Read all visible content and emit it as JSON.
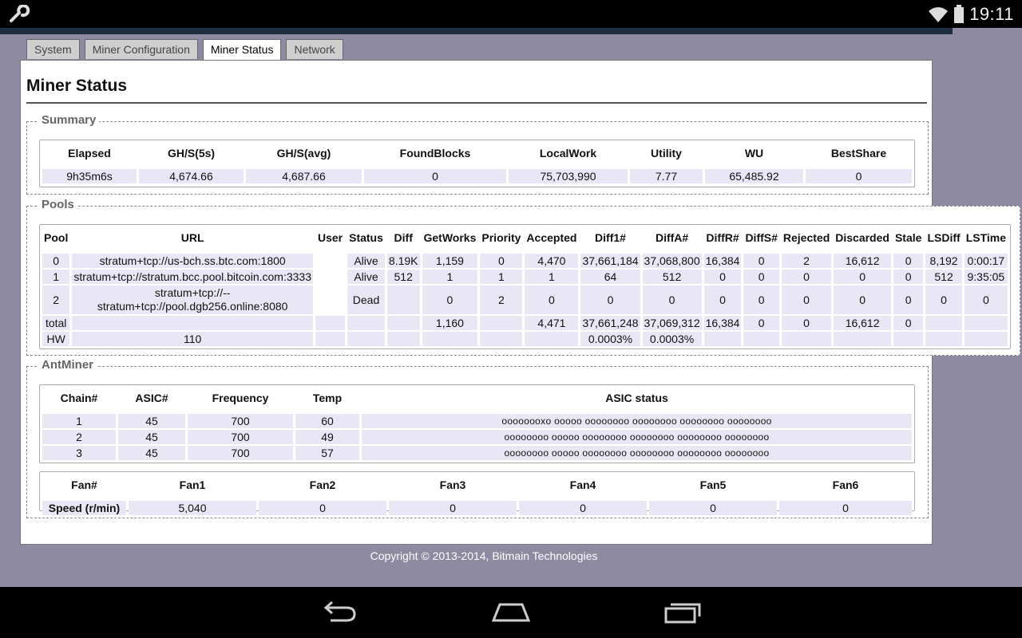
{
  "statusbar": {
    "time": "19:11",
    "icons": [
      "wrench-icon",
      "wifi-icon",
      "battery-icon"
    ]
  },
  "tabs": [
    {
      "label": "System",
      "active": false
    },
    {
      "label": "Miner Configuration",
      "active": false
    },
    {
      "label": "Miner Status",
      "active": true
    },
    {
      "label": "Network",
      "active": false
    }
  ],
  "page": {
    "title": "Miner Status"
  },
  "summary": {
    "title": "Summary",
    "headers": [
      "Elapsed",
      "GH/S(5s)",
      "GH/S(avg)",
      "FoundBlocks",
      "LocalWork",
      "Utility",
      "WU",
      "BestShare"
    ],
    "row": [
      "9h35m6s",
      "4,674.66",
      "4,687.66",
      "0",
      "75,703,990",
      "7.77",
      "65,485.92",
      "0"
    ]
  },
  "pools": {
    "title": "Pools",
    "headers": [
      "Pool",
      "URL",
      "User",
      "Status",
      "Diff",
      "GetWorks",
      "Priority",
      "Accepted",
      "Diff1#",
      "DiffA#",
      "DiffR#",
      "DiffS#",
      "Rejected",
      "Discarded",
      "Stale",
      "LSDiff",
      "LSTime"
    ],
    "rows": [
      [
        "0",
        "stratum+tcp://us-bch.ss.btc.com:1800",
        "",
        "Alive",
        "8.19K",
        "1,159",
        "0",
        "4,470",
        "37,661,184",
        "37,068,800",
        "16,384",
        "0",
        "2",
        "16,612",
        "0",
        "8,192",
        "0:00:17"
      ],
      [
        "1",
        "stratum+tcp://stratum.bcc.pool.bitcoin.com:3333",
        "",
        "Alive",
        "512",
        "1",
        "1",
        "1",
        "64",
        "512",
        "0",
        "0",
        "0",
        "0",
        "0",
        "512",
        "9:35:05"
      ],
      [
        "2",
        "stratum+tcp://-- stratum+tcp://pool.dgb256.online:8080",
        "",
        "Dead",
        "",
        "0",
        "2",
        "0",
        "0",
        "0",
        "0",
        "0",
        "0",
        "0",
        "0",
        "0",
        "0"
      ],
      [
        "total",
        "",
        "",
        "",
        "",
        "1,160",
        "",
        "4,471",
        "37,661,248",
        "37,069,312",
        "16,384",
        "0",
        "0",
        "16,612",
        "0",
        "",
        ""
      ],
      [
        "HW",
        "110",
        "",
        "",
        "",
        "",
        "",
        "",
        "0.0003%",
        "0.0003%",
        "",
        "",
        "",
        "",
        "",
        "",
        ""
      ]
    ]
  },
  "antminer": {
    "title": "AntMiner",
    "chain_headers": [
      "Chain#",
      "ASIC#",
      "Frequency",
      "Temp",
      "ASIC status"
    ],
    "chains": [
      [
        "1",
        "45",
        "700",
        "60",
        "oooooooxo ooooo oooooooo oooooooo oooooooo oooooooo"
      ],
      [
        "2",
        "45",
        "700",
        "49",
        "oooooooo ooooo oooooooo oooooooo oooooooo oooooooo"
      ],
      [
        "3",
        "45",
        "700",
        "57",
        "oooooooo ooooo oooooooo oooooooo oooooooo oooooooo"
      ]
    ],
    "fan_headers": [
      "Fan#",
      "Fan1",
      "Fan2",
      "Fan3",
      "Fan4",
      "Fan5",
      "Fan6"
    ],
    "fan_row": [
      "Speed (r/min)",
      "5,040",
      "0",
      "0",
      "0",
      "0",
      "0"
    ]
  },
  "footer": {
    "copyright": "Copyright © 2013-2014, Bitmain Technologies"
  },
  "navbar": {
    "buttons": [
      "back-icon",
      "home-icon",
      "recents-icon"
    ]
  }
}
